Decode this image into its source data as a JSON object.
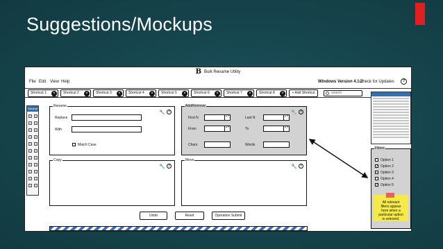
{
  "slide": {
    "title": "Suggestions/Mockups"
  },
  "window": {
    "logo": "B",
    "title": "Bulk Rename Utility"
  },
  "menu": {
    "items": [
      "File",
      "Edit",
      "View",
      "Help"
    ],
    "version": "Windows Version 4.1.2",
    "updates": "Check for Updates",
    "help_icon": "?"
  },
  "shortcuts": [
    "Shortcut 1",
    "Shortcut 2",
    "Shortcut 3",
    "Shortcut 4",
    "Shortcut 5",
    "Shortcut 6",
    "Shortcut 7",
    "Shortcut 8"
  ],
  "add_shortcut": "+ Add Shortcut",
  "search": {
    "placeholder": "search"
  },
  "toolbox": {
    "title": "General"
  },
  "rename": {
    "legend": "Rename",
    "replace_label": "Replace",
    "with_label": "With",
    "match_case_label": "Match Case"
  },
  "add_remove": {
    "legend": "Add/Remove",
    "first_n": "First N",
    "last_n": "Last N",
    "from": "From",
    "to": "To",
    "chars": "Chars",
    "words": "Words"
  },
  "copy": {
    "legend": "Copy"
  },
  "move": {
    "legend": "Move"
  },
  "buttons": {
    "undo": "Undo",
    "reset": "Reset",
    "submit": "Operation Submit"
  },
  "filters": {
    "legend": "Filters",
    "options": [
      {
        "label": "Option 1",
        "checked": false
      },
      {
        "label": "Option 2",
        "checked": true
      },
      {
        "label": "Option 3",
        "checked": "partial"
      },
      {
        "label": "Option 4",
        "checked": false
      },
      {
        "label": "Option 5",
        "checked": true
      }
    ]
  },
  "note": {
    "line1": "All relevant",
    "line2": "filters appear",
    "line3": "here when a",
    "line4": "particular option",
    "line5": "is selected."
  },
  "colors": {
    "background": "#17474f",
    "note": "#f6ea4a",
    "accent": "#e02020",
    "progress": "#3f6fb5"
  }
}
